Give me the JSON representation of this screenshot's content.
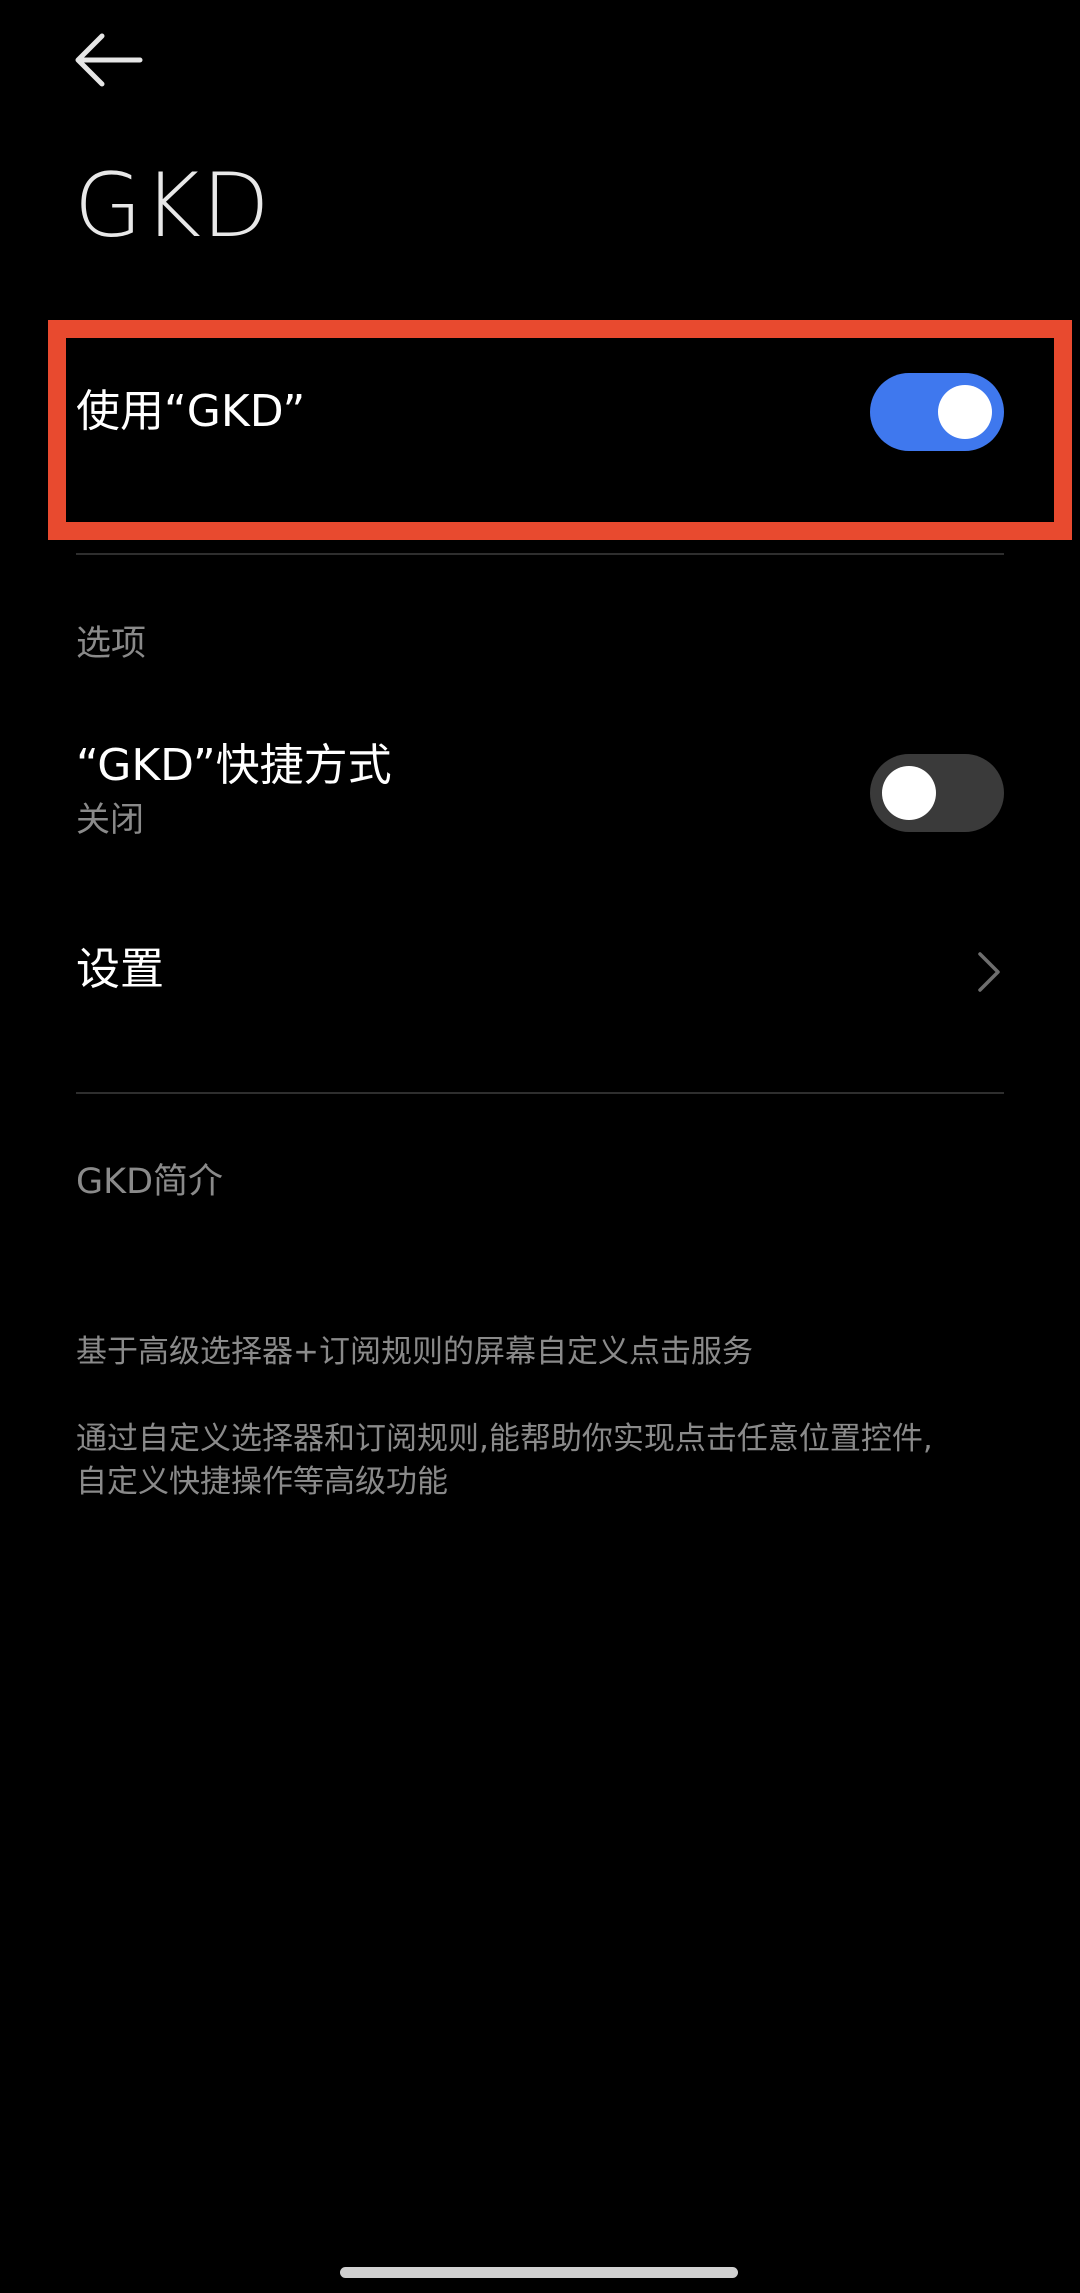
{
  "header": {
    "back_icon": "arrow-left-icon",
    "title": "GKD"
  },
  "use_service": {
    "label": "使用“GKD”",
    "enabled": true,
    "toggle_on_color": "#3f78ee",
    "toggle_off_color": "#3a3a3a"
  },
  "highlight_color": "#e84a2f",
  "options": {
    "section_label": "选项",
    "shortcut": {
      "label": "“GKD”快捷方式",
      "status": "关闭",
      "enabled": false
    },
    "settings": {
      "label": "设置",
      "chevron_icon": "chevron-right-icon"
    }
  },
  "about": {
    "section_label": "GKD简介",
    "summary": "基于高级选择器+订阅规则的屏幕自定义点击服务",
    "details_line1": "通过自定义选择器和订阅规则,能帮助你实现点击任意位置控件,",
    "details_line2": "自定义快捷操作等高级功能"
  }
}
